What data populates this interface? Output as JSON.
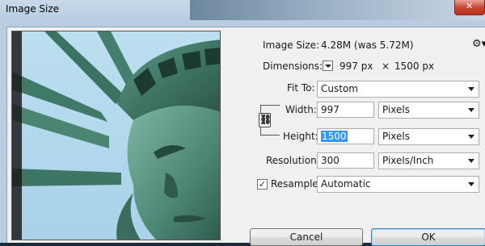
{
  "window": {
    "title": "Image Size"
  },
  "info": {
    "image_size_label": "Image Size:",
    "image_size_value": "4.28M (was 5.72M)",
    "dimensions_label": "Dimensions:",
    "width_px": "997 px",
    "times": "×",
    "height_px": "1500 px"
  },
  "fit_to": {
    "label": "Fit To:",
    "value": "Custom"
  },
  "width": {
    "label": "Width:",
    "value": "997",
    "unit": "Pixels"
  },
  "height": {
    "label": "Height:",
    "value": "1500",
    "unit": "Pixels"
  },
  "resolution": {
    "label": "Resolution:",
    "value": "300",
    "unit": "Pixels/Inch"
  },
  "resample": {
    "label": "Resample:",
    "checked": "✓",
    "value": "Automatic"
  },
  "buttons": {
    "cancel": "Cancel",
    "ok": "OK"
  },
  "icons": {
    "settings": "gear-icon",
    "link": "chain-link-icon",
    "close": "close-icon"
  }
}
